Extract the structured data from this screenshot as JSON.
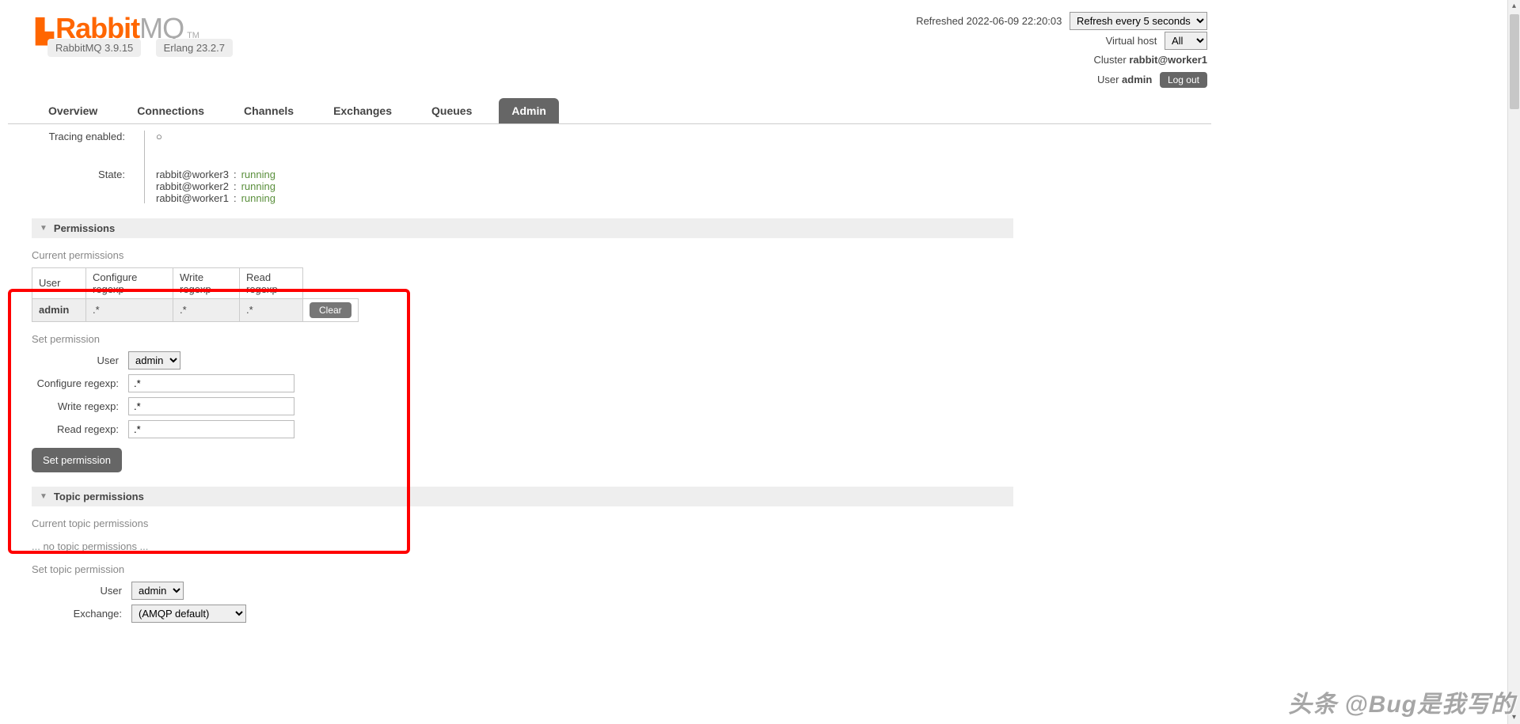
{
  "logo": {
    "rabbit": "Rabbit",
    "mq": "MQ",
    "tm": "TM"
  },
  "badges": {
    "version": "RabbitMQ 3.9.15",
    "erlang": "Erlang 23.2.7"
  },
  "status": {
    "refreshed": "Refreshed 2022-06-09 22:20:03",
    "refresh_select": "Refresh every 5 seconds",
    "vhost_label": "Virtual host",
    "vhost_value": "All",
    "cluster_label": "Cluster",
    "cluster_value": "rabbit@worker1",
    "user_label": "User",
    "user_value": "admin",
    "logout": "Log out"
  },
  "tabs": [
    "Overview",
    "Connections",
    "Channels",
    "Exchanges",
    "Queues",
    "Admin"
  ],
  "active_tab": "Admin",
  "tracing": {
    "label": "Tracing enabled:",
    "value": "○"
  },
  "state": {
    "label": "State:",
    "nodes": [
      {
        "name": "rabbit@worker3",
        "status": "running"
      },
      {
        "name": "rabbit@worker2",
        "status": "running"
      },
      {
        "name": "rabbit@worker1",
        "status": "running"
      }
    ]
  },
  "sections": {
    "permissions": "Permissions",
    "topic_permissions": "Topic permissions"
  },
  "current_permissions": {
    "title": "Current permissions",
    "headers": [
      "User",
      "Configure regexp",
      "Write regexp",
      "Read regexp"
    ],
    "row": {
      "user": "admin",
      "conf": ".*",
      "write": ".*",
      "read": ".*"
    },
    "clear": "Clear"
  },
  "set_permission": {
    "title": "Set permission",
    "user_label": "User",
    "user_value": "admin",
    "conf_label": "Configure regexp:",
    "conf_value": ".*",
    "write_label": "Write regexp:",
    "write_value": ".*",
    "read_label": "Read regexp:",
    "read_value": ".*",
    "button": "Set permission"
  },
  "topic": {
    "current": "Current topic permissions",
    "none": "... no topic permissions ...",
    "set_title": "Set topic permission",
    "user_label": "User",
    "user_value": "admin",
    "exchange_label": "Exchange:",
    "exchange_value": "(AMQP default)"
  },
  "watermark": "头条 @Bug是我写的"
}
